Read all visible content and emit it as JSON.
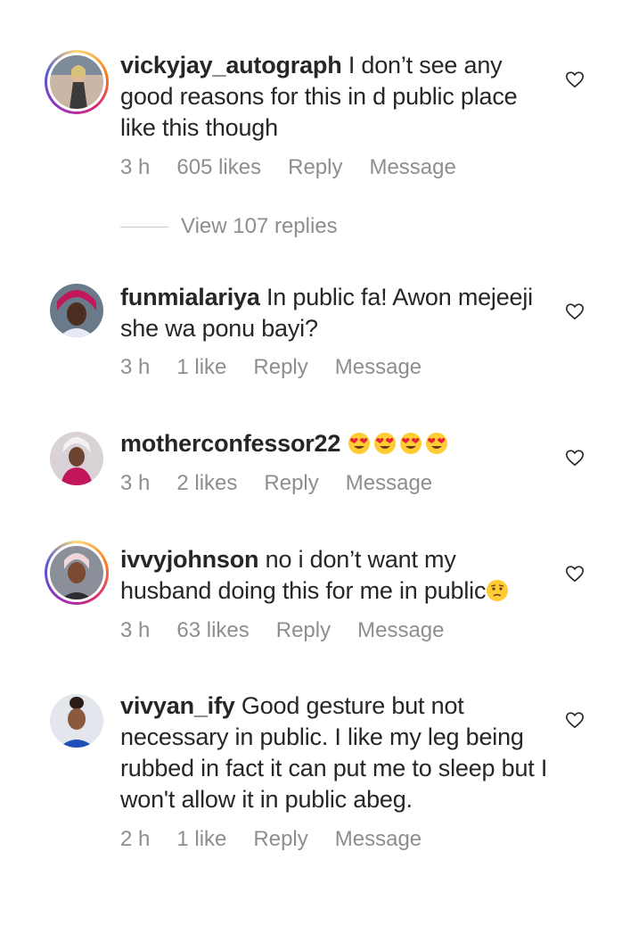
{
  "comments": [
    {
      "username": "vickyjay_autograph",
      "text": " I don’t see any good reasons for this in d public place like this though",
      "time": "3 h",
      "likes": "605 likes",
      "reply": "Reply",
      "message": "Message",
      "has_story_ring": true
    },
    {
      "username": "funmialariya",
      "text": " In public fa! Awon mejeeji she wa ponu bayi?",
      "time": "3 h",
      "likes": "1 like",
      "reply": "Reply",
      "message": "Message",
      "has_story_ring": false
    },
    {
      "username": "motherconfessor22",
      "text": " ",
      "time": "3 h",
      "likes": "2 likes",
      "reply": "Reply",
      "message": "Message",
      "has_story_ring": false
    },
    {
      "username": "ivvyjohnson",
      "text": " no i don’t want my husband doing this for me in public",
      "time": "3 h",
      "likes": "63 likes",
      "reply": "Reply",
      "message": "Message",
      "has_story_ring": true
    },
    {
      "username": "vivyan_ify",
      "text": " Good gesture but not necessary in public. I like my leg being rubbed in fact it can put me to sleep but I won't allow it in public abeg.",
      "time": "2 h",
      "likes": "1 like",
      "reply": "Reply",
      "message": "Message",
      "has_story_ring": false
    }
  ],
  "view_replies": "View 107 replies",
  "icons": {
    "like": "heart-outline-icon",
    "emoji_heart_eyes": "heart-eyes-emoji-icon",
    "emoji_worried": "worried-face-emoji-icon"
  },
  "colors": {
    "text": "#262626",
    "secondary": "#8e8e8e",
    "ring_start": "#feda75",
    "ring_end": "#962fbf"
  }
}
